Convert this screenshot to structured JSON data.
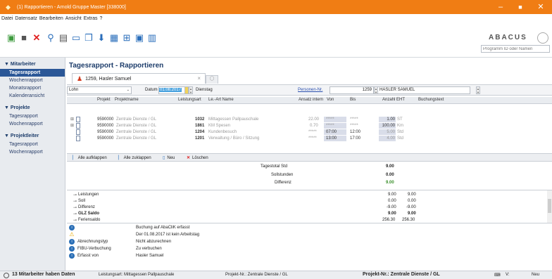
{
  "window": {
    "title": "(1) Rapportieren - Arnold Gruppe Master [338000]",
    "min_glyph": "–",
    "max_glyph": "■",
    "close_glyph": "✕"
  },
  "menu": [
    "Datei",
    "Datensatz",
    "Bearbeiten",
    "Ansicht",
    "Extras",
    "?"
  ],
  "toolbar": {
    "brand": "ABACUS",
    "search_placeholder": "Programm ID oder Namen"
  },
  "sidebar": {
    "groups": [
      {
        "label": "Mitarbeiter",
        "items": [
          "Tagesrapport",
          "Wochenrapport",
          "Monatsrapport",
          "Kalenderansicht"
        ]
      },
      {
        "label": "Projekte",
        "items": [
          "Tagesrapport",
          "Wochenrapport"
        ]
      },
      {
        "label": "Projektleiter",
        "items": [
          "Tagesrapport",
          "Wochenrapport"
        ]
      }
    ],
    "active": "Tagesrapport"
  },
  "page": {
    "title": "Tagesrapport - Rapportieren",
    "tab_label": "1259, Hasler Samuel"
  },
  "filter": {
    "type": "Lohn",
    "date_label": "Datum",
    "date_value": "01.08.2017",
    "weekday": "Dienstag",
    "person_label": "Personen-Nr.",
    "person_nr": "1259",
    "person_name": "HASLER SAMUEL"
  },
  "grid": {
    "headers": [
      "Projekt",
      "Projektname",
      "Leistungsart",
      "Le.-Art Name",
      "Ansatz intern",
      "Von",
      "Bis",
      "Anzahl",
      "EHT",
      "Buchungstext"
    ],
    "rows": [
      {
        "projekt": "9590000",
        "projektname": "Zentrale Dienste / GL",
        "la": "1032",
        "la_name": "Mittagessen Pallpauschale",
        "ansatz": "22.00",
        "von": "*****",
        "bis": "*****",
        "anzahl": "1.00",
        "eht": "ST"
      },
      {
        "projekt": "9590000",
        "projektname": "Zentrale Dienste / GL",
        "la": "1861",
        "la_name": "KM Spesen",
        "ansatz": "0.70",
        "von": "*****",
        "bis": "*****",
        "anzahl": "100.00",
        "eht": "Km"
      },
      {
        "projekt": "9590000",
        "projektname": "Zentrale Dienste / GL",
        "la": "1204",
        "la_name": "Kundenbesuch",
        "ansatz": "*****",
        "von": "07:00",
        "bis": "12:00",
        "anzahl": "5.00",
        "eht": "Std"
      },
      {
        "projekt": "9590000",
        "projektname": "Zentrale Dienste / GL",
        "la": "1201",
        "la_name": "Verwaltung / Büro / Sitzung",
        "ansatz": "*****",
        "von": "13:00",
        "bis": "17:00",
        "anzahl": "4.00",
        "eht": "Std"
      }
    ]
  },
  "grid_toolbar": {
    "expand_all": "Alle aufklappen",
    "collapse_all": "Alle zuklappen",
    "new": "Neu",
    "delete": "Löschen"
  },
  "totals": [
    {
      "label": "Tagestotal Std",
      "value": "9.00"
    },
    {
      "label": "Sollstunden",
      "value": "0.00"
    },
    {
      "label": "Differenz",
      "value": "9.00"
    }
  ],
  "tree": [
    {
      "label": "Leistungen",
      "a": "9.00",
      "b": "9.00",
      "bold": false
    },
    {
      "label": "Soll",
      "a": "0.00",
      "b": "0.00",
      "bold": false
    },
    {
      "label": "Differenz",
      "a": "-9.00",
      "b": "-9.00",
      "bold": false
    },
    {
      "label": "GLZ Saldo",
      "a": "9.00",
      "b": "9.00",
      "bold": true
    },
    {
      "label": "Feriensaldo",
      "a": "256.30",
      "b": "256.30",
      "bold": false
    }
  ],
  "info": [
    {
      "icon": "info",
      "key": "",
      "value": "Buchung auf AbaCliK erfasst"
    },
    {
      "icon": "warning",
      "key": "",
      "value": "Der 01.08.2017 ist kein Arbeitstag"
    },
    {
      "icon": "info",
      "key": "Abrechnungstyp",
      "value": "Nicht abzurechnen"
    },
    {
      "icon": "info",
      "key": "FIBU-Verbuchung",
      "value": "Zu verbuchen"
    },
    {
      "icon": "info",
      "key": "Erfasst von",
      "value": "Hasler Samuel"
    }
  ],
  "status": {
    "count": "13 Mitarbeiter haben Daten",
    "leistungsart": "Leistungsart: Mittagessen Pallpauschale",
    "projekt": "Projekt-Nr.: Zentrale Dienste / GL",
    "projekt_bold": "Projekt-Nr.: Zentrale Dienste / GL",
    "v": "V:",
    "mode": "Neu"
  }
}
